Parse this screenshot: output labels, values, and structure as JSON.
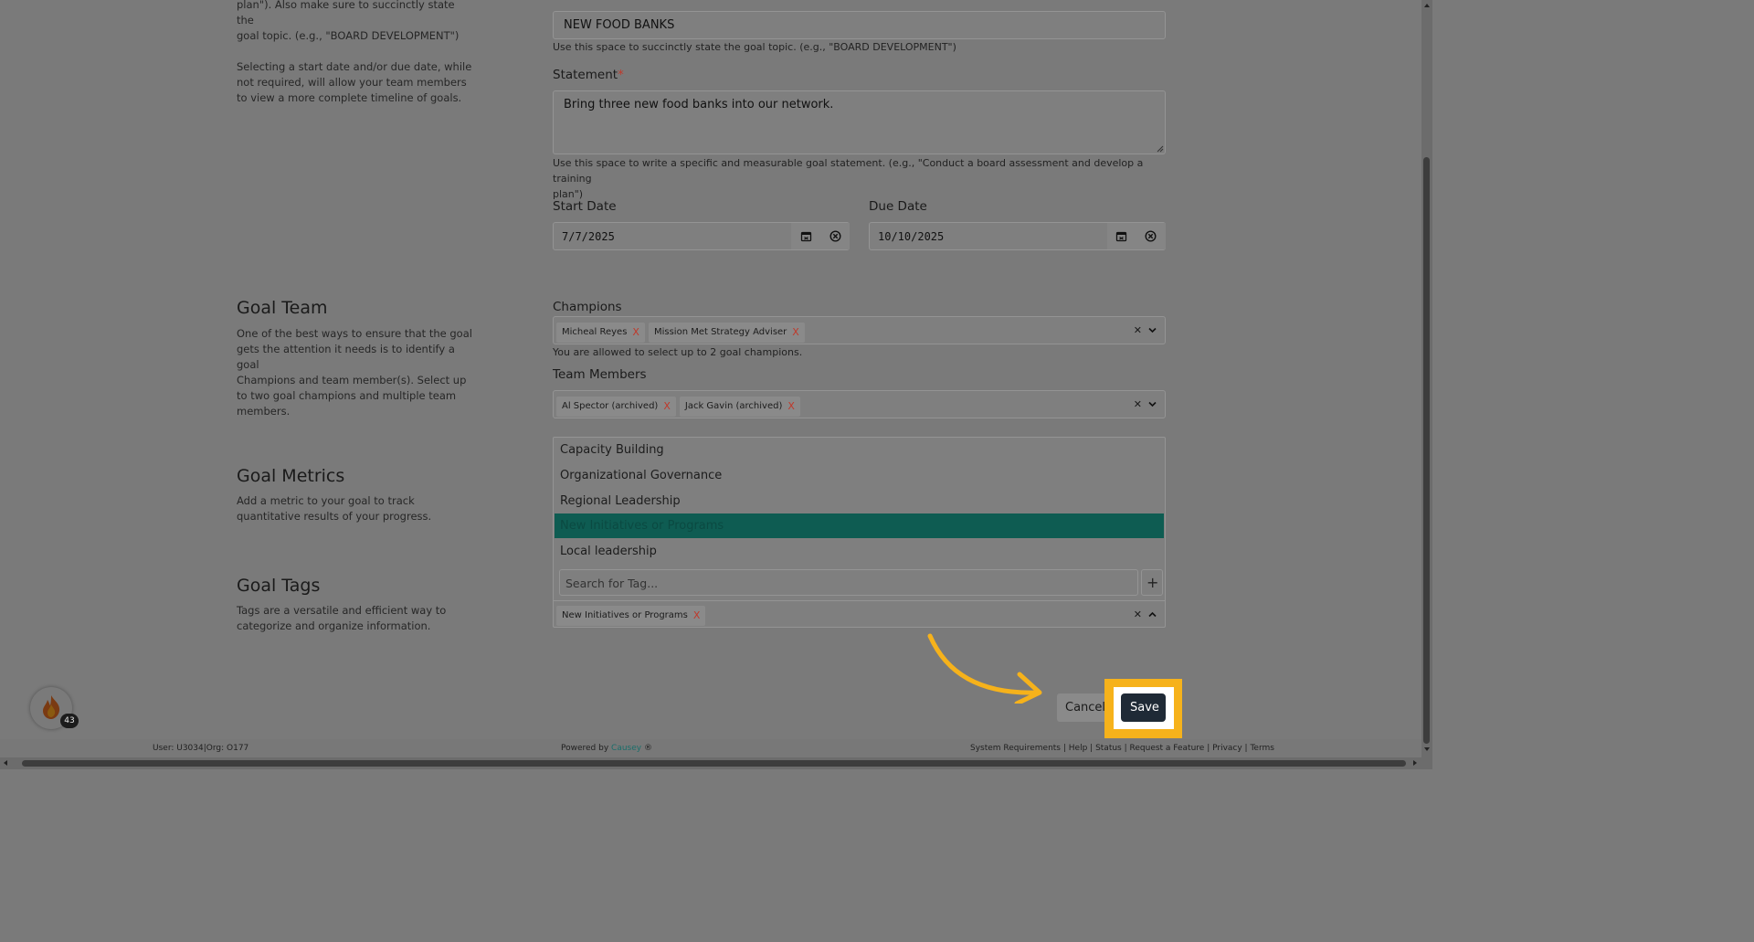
{
  "intro": {
    "line1": "plan\"). Also make sure to succinctly state the",
    "line2": "goal topic. (e.g., \"BOARD DEVELOPMENT\")",
    "para2_l1": "Selecting a start date and/or due date, while",
    "para2_l2": "not required, will allow your team members",
    "para2_l3": "to view a more complete timeline of goals."
  },
  "topic": {
    "value": "NEW FOOD BANKS",
    "hint": "Use this space to succinctly state the goal topic. (e.g., \"BOARD DEVELOPMENT\")"
  },
  "statement": {
    "label": "Statement",
    "required_mark": "*",
    "value": "Bring three new food banks into our network.",
    "hint_l1": "Use this space to write a specific and measurable goal statement. (e.g., \"Conduct a board assessment and develop a training",
    "hint_l2": "plan\")"
  },
  "start_date": {
    "label": "Start Date",
    "value": "7/7/2025"
  },
  "due_date": {
    "label": "Due Date",
    "value": "10/10/2025"
  },
  "goal_team": {
    "title": "Goal Team",
    "desc_l1": "One of the best ways to ensure that the goal",
    "desc_l2": "gets the attention it needs is to identify a goal",
    "desc_l3": "Champions and team member(s). Select up",
    "desc_l4": "to two goal champions and multiple team",
    "desc_l5": "members."
  },
  "champions": {
    "label": "Champions",
    "chips": [
      "Micheal Reyes",
      "Mission Met Strategy Adviser"
    ],
    "hint": "You are allowed to select up to 2 goal champions."
  },
  "team_members": {
    "label": "Team Members",
    "chips": [
      "Al Spector (archived)",
      "Jack Gavin (archived)"
    ]
  },
  "goal_metrics": {
    "title": "Goal Metrics",
    "desc_l1": "Add a metric to your goal to track",
    "desc_l2": "quantitative results of your progress."
  },
  "tag_options": [
    "Capacity Building",
    "Organizational Governance",
    "Regional Leadership",
    "New Initiatives or Programs",
    "Local leadership"
  ],
  "goal_tags": {
    "title": "Goal Tags",
    "desc_l1": "Tags are a versatile and efficient way to",
    "desc_l2": "categorize and organize information.",
    "search_placeholder": "Search for Tag...",
    "selected_chip": "New Initiatives or Programs"
  },
  "actions": {
    "cancel": "Cancel",
    "save": "Save"
  },
  "badge_count": "43",
  "footer": {
    "user": "User: U3034|Org: O177",
    "powered_prefix": "Powered by",
    "brand": "Causey",
    "reg": "®",
    "links": [
      "System Requirements",
      "Help",
      "Status",
      "Request a Feature",
      "Privacy",
      "Terms"
    ]
  },
  "colors": {
    "highlight": "#f6b21b",
    "selected_option": "#0e5c52",
    "save_bg": "#1f2a36",
    "brand": "#1a6e6a"
  },
  "icons": [
    "calendar-icon",
    "clear-circle-icon",
    "chevron-down-icon",
    "chevron-up-icon",
    "plus-icon",
    "flame-icon",
    "arrow-icon"
  ]
}
